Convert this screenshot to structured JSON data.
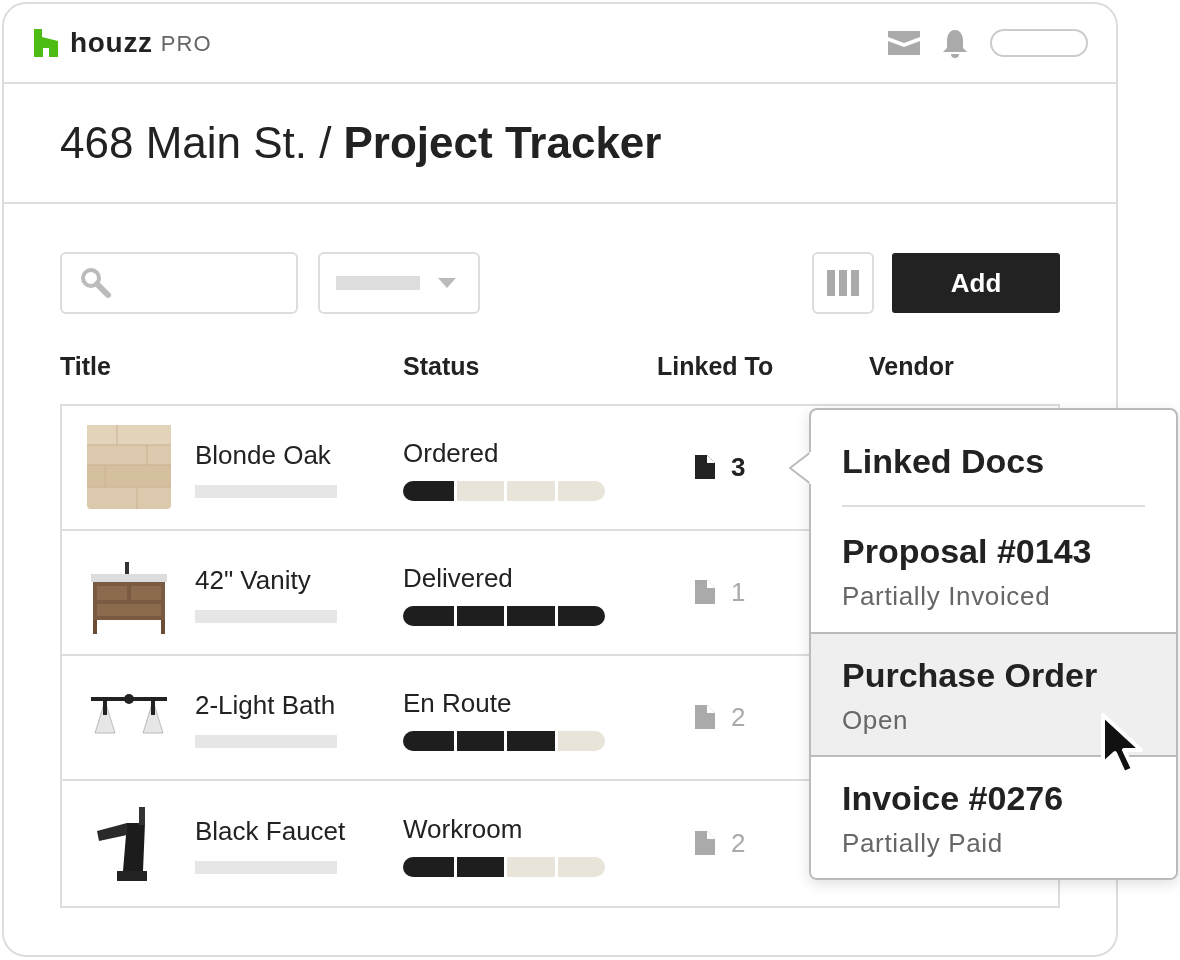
{
  "header": {
    "logo": "houzz",
    "logo_suffix": "PRO"
  },
  "title": {
    "location": "468 Main St. /",
    "page": "Project Tracker"
  },
  "toolbar": {
    "add_button": "Add"
  },
  "table": {
    "columns": [
      "Title",
      "Status",
      "Linked To",
      "Vendor"
    ],
    "rows": [
      {
        "title": "Blonde Oak",
        "status": "Ordered",
        "level": 0.25,
        "linked_count": "3",
        "selected": true
      },
      {
        "title": "42\" Vanity",
        "status": "Delivered",
        "level": 1,
        "linked_count": "1",
        "selected": false
      },
      {
        "title": "2-Light Bath",
        "status": "En Route",
        "level": 0.75,
        "linked_count": "2",
        "selected": false
      },
      {
        "title": "Black Faucet",
        "status": "Workroom",
        "level": 0.5,
        "linked_count": "2",
        "selected": false
      }
    ]
  },
  "popover": {
    "title": "Linked Docs",
    "items": [
      {
        "name": "Proposal #0143",
        "status": "Partially Invoiced",
        "selected": false
      },
      {
        "name": "Purchase Order",
        "status": "Open",
        "selected": true
      },
      {
        "name": "Invoice #0276",
        "status": "Partially Paid",
        "selected": false
      }
    ]
  }
}
